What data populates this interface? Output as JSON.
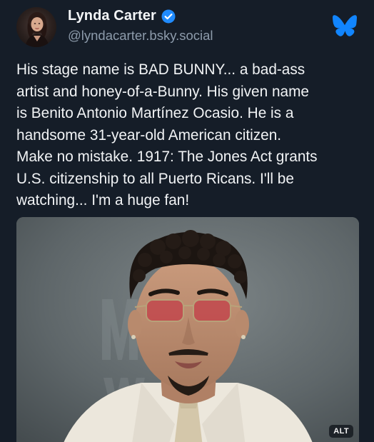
{
  "author": {
    "display_name": "Lynda Carter",
    "handle": "@lyndacarter.bsky.social",
    "verified": true
  },
  "post": {
    "text": "His stage name is BAD BUNNY... a bad-ass\nartist and honey-of-a-Bunny. His given name\nis Benito Antonio Martínez Ocasio. He is a\nhandsome 31-year-old American citizen.\nMake no mistake. 1917: The Jones Act grants\nU.S. citizenship to all Puerto Ricans. I'll be\nwatching... I'm a huge fan!"
  },
  "media": {
    "alt_badge": "ALT"
  },
  "icons": {
    "verified": "verified-check-icon",
    "logo": "bluesky-butterfly-icon"
  },
  "colors": {
    "background": "#151d28",
    "verified": "#208bfe",
    "logo": "#1185fe",
    "handle": "#8d9bab"
  }
}
